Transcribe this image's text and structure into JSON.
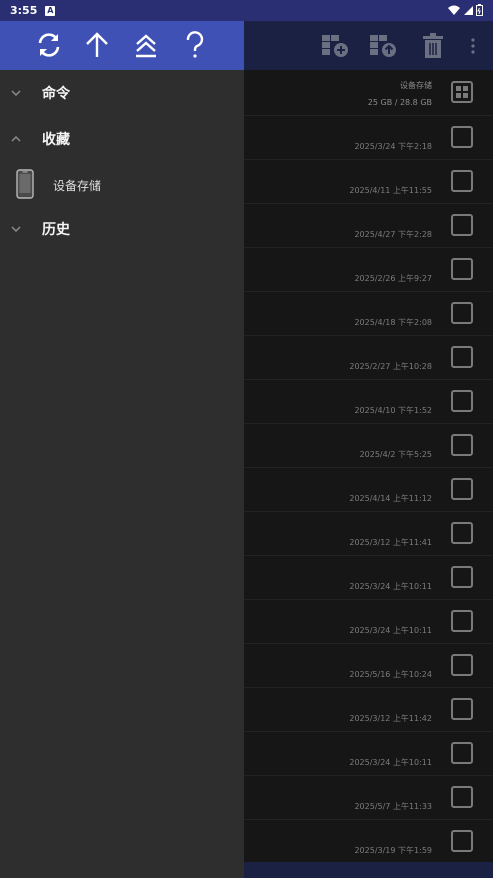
{
  "status": {
    "time": "3:55",
    "indicator": "A"
  },
  "drawer": {
    "toolbar_icons": [
      "refresh-icon",
      "arrow-up-icon",
      "collapse-all-icon",
      "help-icon"
    ],
    "sections": [
      {
        "label": "命令",
        "expanded": false
      },
      {
        "label": "收藏",
        "expanded": true
      },
      {
        "label": "历史",
        "expanded": false
      }
    ],
    "favorites": [
      {
        "label": "设备存储",
        "icon": "phone-icon"
      }
    ]
  },
  "toolbar": {
    "icons": [
      "add-folder-icon",
      "upload-folder-icon",
      "delete-icon",
      "more-icon"
    ]
  },
  "storage": {
    "title": "设备存储",
    "size": "25 GB / 28.8 GB"
  },
  "files": [
    {
      "date": "2025/3/24 下午2:18"
    },
    {
      "date": "2025/4/11 上午11:55"
    },
    {
      "date": "2025/4/27 下午2:28"
    },
    {
      "date": "2025/2/26 上午9:27"
    },
    {
      "date": "2025/4/18 下午2:08"
    },
    {
      "date": "2025/2/27 上午10:28"
    },
    {
      "date": "2025/4/10 下午1:52"
    },
    {
      "date": "2025/4/2 下午5:25"
    },
    {
      "date": "2025/4/14 上午11:12"
    },
    {
      "date": "2025/3/12 上午11:41"
    },
    {
      "date": "2025/3/24 上午10:11"
    },
    {
      "date": "2025/3/24 上午10:11"
    },
    {
      "date": "2025/5/16 上午10:24"
    },
    {
      "date": "2025/3/12 上午11:42"
    },
    {
      "date": "2025/3/24 上午10:11"
    },
    {
      "date": "2025/5/7 上午11:33"
    },
    {
      "date": "2025/3/19 下午1:59"
    }
  ],
  "colors": {
    "drawer_header": "#3f51b5",
    "status_bar": "#2a2f73",
    "drawer_bg": "#2e2e2e"
  }
}
